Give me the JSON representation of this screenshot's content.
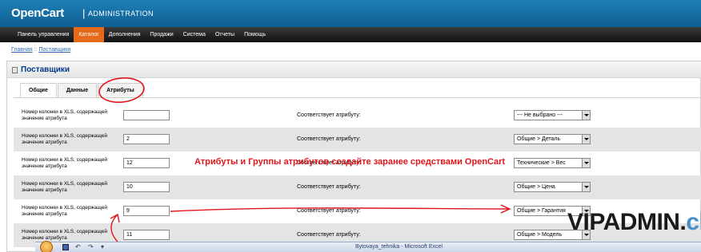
{
  "header": {
    "logo": "OpenCart",
    "separator": "|",
    "subtitle": "ADMINISTRATION"
  },
  "menu": {
    "items": [
      {
        "label": "Панель управления",
        "active": false
      },
      {
        "label": "Каталог",
        "active": true
      },
      {
        "label": "Дополнения",
        "active": false
      },
      {
        "label": "Продажи",
        "active": false
      },
      {
        "label": "Система",
        "active": false
      },
      {
        "label": "Отчеты",
        "active": false
      },
      {
        "label": "Помощь",
        "active": false
      }
    ]
  },
  "breadcrumb": {
    "home": "Главная",
    "separator": "::",
    "current": "Поставщики"
  },
  "panel": {
    "title": "Поставщики",
    "icon": "document-icon"
  },
  "tabs": [
    {
      "label": "Общие",
      "active": true
    },
    {
      "label": "Данные",
      "active": false
    },
    {
      "label": "Атрибуты",
      "active": false
    }
  ],
  "rows": [
    {
      "label": "Номер колонки в XLS, содержащей значение атрибута",
      "column": "",
      "match_label": "Соответствует атрибуту:",
      "selected": "--- Не выбрано ---"
    },
    {
      "label": "Номер колонки в XLS, содержащей значение атрибута",
      "column": "2",
      "match_label": "Соответствует атрибуту:",
      "selected": "Общие > Деталь"
    },
    {
      "label": "Номер колонки в XLS, содержащей значение атрибута",
      "column": "12",
      "match_label": "Соответствует атрибуту:",
      "selected": "Технические > Вес"
    },
    {
      "label": "Номер колонки в XLS, содержащей значение атрибута",
      "column": "10",
      "match_label": "Соответствует атрибуту:",
      "selected": "Общие > Цена"
    },
    {
      "label": "Номер колонки в XLS, содержащей значение атрибута",
      "column": "9",
      "match_label": "Соответствует атрибуту:",
      "selected": "Общие > Гарантия"
    },
    {
      "label": "Номер колонки в XLS, содержащей значение атрибута",
      "column": "11",
      "match_label": "Соответствует атрибуту:",
      "selected": "Общие > Модель"
    }
  ],
  "annotation": {
    "text": "Атрибуты и Группы атрибутов создайте заранее средствами OpenCart",
    "color": "#e0161c"
  },
  "watermark": {
    "main": "VIPADMIN.",
    "suffix": "club"
  },
  "excel": {
    "title": "Bytovaya_tehnika - Microsoft Excel",
    "undo_icon": "undo-icon",
    "redo_icon": "redo-icon"
  },
  "colors": {
    "header": "#1f7fb5",
    "menu_active": "#e66a1b",
    "panel_title": "#003a88",
    "accent_red": "#e0161c"
  }
}
